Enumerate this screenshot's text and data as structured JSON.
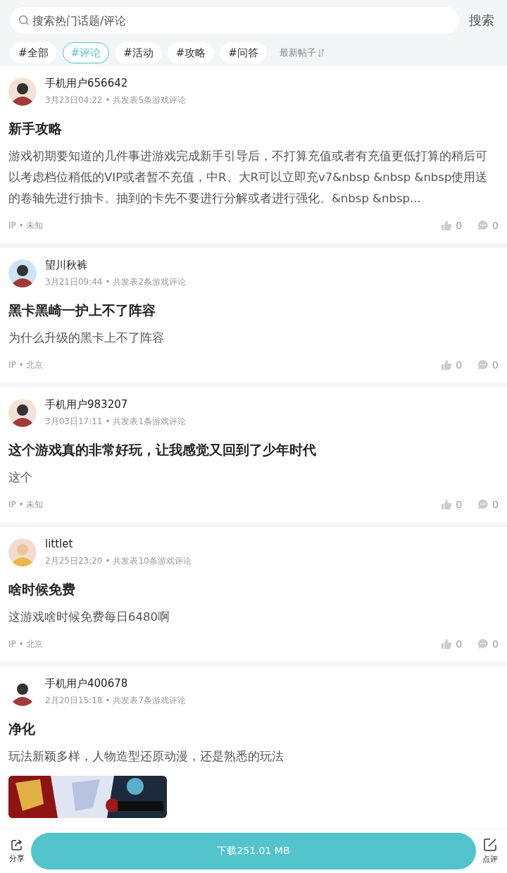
{
  "search": {
    "placeholder": "搜索热门话题/评论",
    "button": "搜索"
  },
  "tabs": [
    {
      "label": "#全部",
      "selected": false
    },
    {
      "label": "#评论",
      "selected": true
    },
    {
      "label": "#活动",
      "selected": false
    },
    {
      "label": "#攻略",
      "selected": false
    },
    {
      "label": "#问答",
      "selected": false
    }
  ],
  "sort": {
    "label": "最新帖子"
  },
  "posts": [
    {
      "user": "手机用户656642",
      "time": "3月23日04:22",
      "meta": "• 共发表5条游戏评论",
      "title": "新手攻略",
      "body": "游戏初期要知道的几件事进游戏完成新手引导后，不打算充值或者有充值更低打算的稍后可以考虑档位稍低的VIP或者暂不充值，中R、大R可以立即充v7&nbsp &nbsp &nbsp使用送的卷轴先进行抽卡。抽到的卡先不要进行分解或者进行强化。&nbsp &nbsp...",
      "ip": "IP • 未知",
      "likes": "0",
      "comments": "0"
    },
    {
      "user": "望川秋裤",
      "time": "3月21日09:44",
      "meta": "• 共发表2条游戏评论",
      "title": "黑卡黑崎一护上不了阵容",
      "body": "为什么升级的黑卡上不了阵容",
      "ip": "IP • 北京",
      "likes": "0",
      "comments": "0"
    },
    {
      "user": "手机用户983207",
      "time": "3月03日17:11",
      "meta": "• 共发表1条游戏评论",
      "title": "这个游戏真的非常好玩，让我感觉又回到了少年时代",
      "body": "这个",
      "ip": "IP • 未知",
      "likes": "0",
      "comments": "0"
    },
    {
      "user": "littlet",
      "time": "2月25日23:20",
      "meta": "• 共发表10条游戏评论",
      "title": "啥时候免费",
      "body": "这游戏啥时候免费每日6480啊",
      "ip": "IP • 北京",
      "likes": "0",
      "comments": "0"
    },
    {
      "user": "手机用户400678",
      "time": "2月20日15:18",
      "meta": "• 共发表7条游戏评论",
      "title": "净化",
      "body": "玩法新颖多样，人物造型还原动漫，还是熟悉的玩法"
    }
  ],
  "bottom_bar": {
    "share": "分享",
    "download": "下载251.01 MB",
    "review": "点评"
  }
}
